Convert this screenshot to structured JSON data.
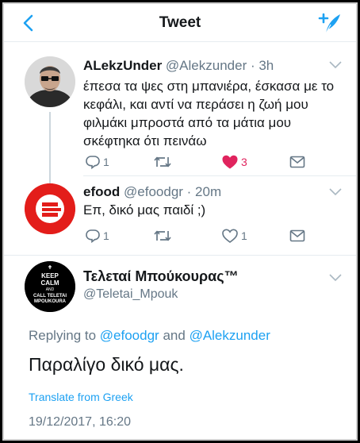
{
  "header": {
    "title": "Tweet"
  },
  "tweets": [
    {
      "name": "ALekzUnder",
      "handle": "@Alekzunder",
      "time": "3h",
      "text": "έπεσα τα ψες στη μπανιέρα, έσκασα με το κεφάλι, και αντί να περάσει η ζωή μου φιλμάκι μπροστά από τα μάτια μου σκέφτηκα ότι πεινάω",
      "reply_count": "1",
      "retweet_count": "",
      "like_count": "3",
      "liked": true
    },
    {
      "name": "efood",
      "handle": "@efoodgr",
      "time": "20m",
      "text": "Επ, δικό μας παιδί ;)",
      "reply_count": "1",
      "retweet_count": "",
      "like_count": "1",
      "liked": false
    }
  ],
  "main_tweet": {
    "name": "Τελεταί Μπούκουρας™",
    "handle": "@Teletai_Mpouk",
    "avatar_text": [
      "KEEP",
      "CALM",
      "AND",
      "CALL TELETAI",
      "MPOUKOURA"
    ],
    "replying_prefix": "Replying to",
    "reply_to_1": "@efoodgr",
    "reply_conj": "and",
    "reply_to_2": "@Alekzunder",
    "text": "Παραλίγο δικό μας.",
    "translate": "Translate from Greek",
    "timestamp": "19/12/2017, 16:20"
  },
  "colors": {
    "twitter_blue": "#1da1f2",
    "like_red": "#e0245e",
    "gray_text": "#657786",
    "efood_red": "#e31d1a"
  },
  "icons": [
    "back-arrow-icon",
    "compose-tweet-icon",
    "chevron-down-icon",
    "reply-icon",
    "retweet-icon",
    "like-icon",
    "share-icon"
  ]
}
